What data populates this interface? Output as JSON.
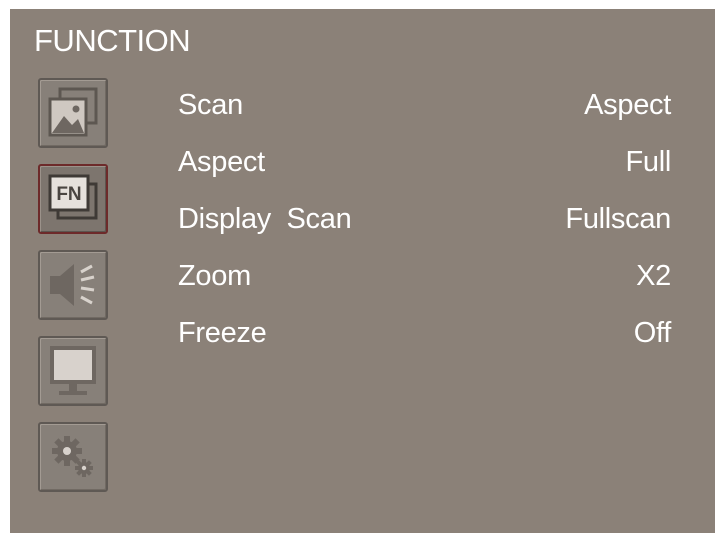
{
  "menu": {
    "title": "FUNCTION"
  },
  "sidebar": {
    "items": [
      {
        "icon": "picture-icon",
        "active": false
      },
      {
        "icon": "function-icon",
        "active": true,
        "label": "FN"
      },
      {
        "icon": "speaker-icon",
        "active": false
      },
      {
        "icon": "monitor-icon",
        "active": false
      },
      {
        "icon": "settings-icon",
        "active": false
      }
    ]
  },
  "settings": [
    {
      "label": "Scan",
      "value": "Aspect"
    },
    {
      "label": "Aspect",
      "value": "Full"
    },
    {
      "label": "Display  Scan",
      "value": "Fullscan"
    },
    {
      "label": "Zoom",
      "value": "X2"
    },
    {
      "label": "Freeze",
      "value": "Off"
    }
  ],
  "colors": {
    "background": "#8b8178",
    "text": "#ffffff",
    "active_border": "#6d2a2a",
    "icon_gray": "#6e6761",
    "icon_light": "#d8d2cc"
  }
}
